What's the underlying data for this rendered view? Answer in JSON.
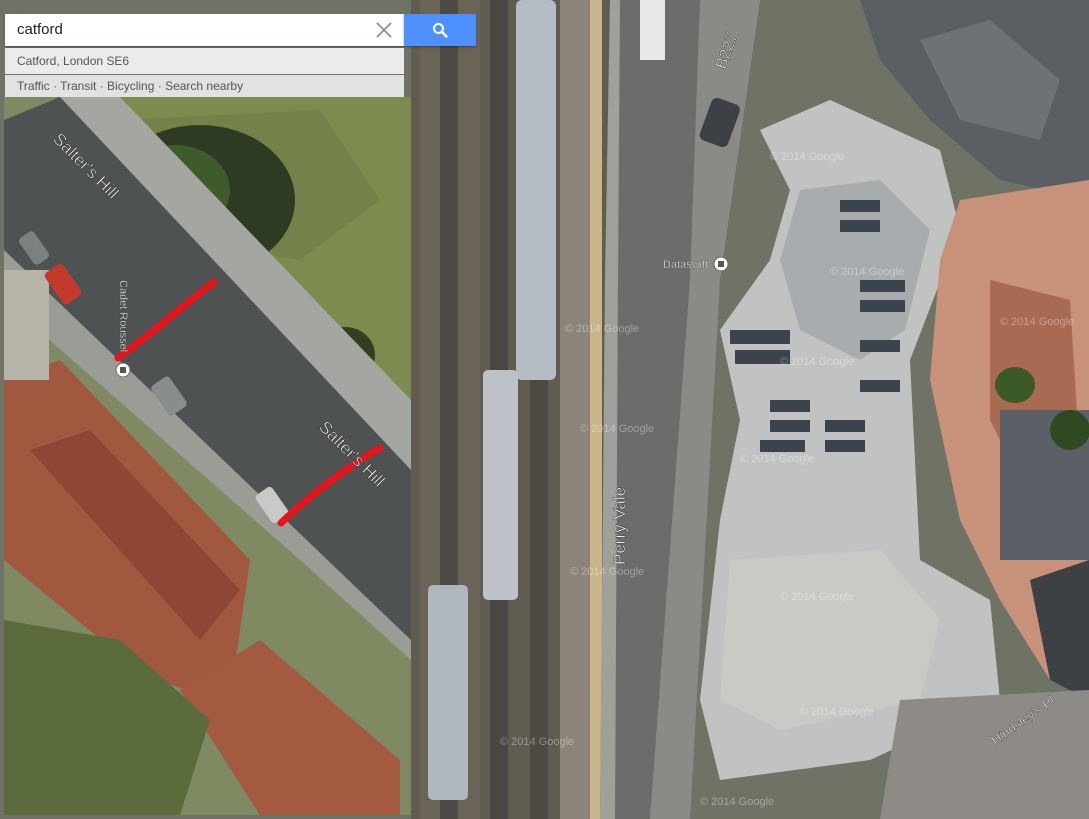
{
  "search": {
    "query": "catford",
    "button_icon": "search-icon",
    "clear_icon": "close-icon",
    "suggestion": "Catford, London SE6"
  },
  "quick_links": [
    "Traffic",
    "Transit",
    "Bicycling",
    "Search nearby"
  ],
  "quick_links_separator": " · ",
  "map": {
    "type": "satellite",
    "streets": {
      "salters_hill_top": "Salter's Hill",
      "salters_hill_bottom": "Salter's Hill",
      "cadet": "Cadet Roussel",
      "b227": "B227",
      "perry_vale": "Perry Vale",
      "hindsley": "Hindsley's Pl"
    },
    "poi": "Dataswift",
    "watermark": "© 2014 Google",
    "annotation_color": "#e8141a"
  }
}
